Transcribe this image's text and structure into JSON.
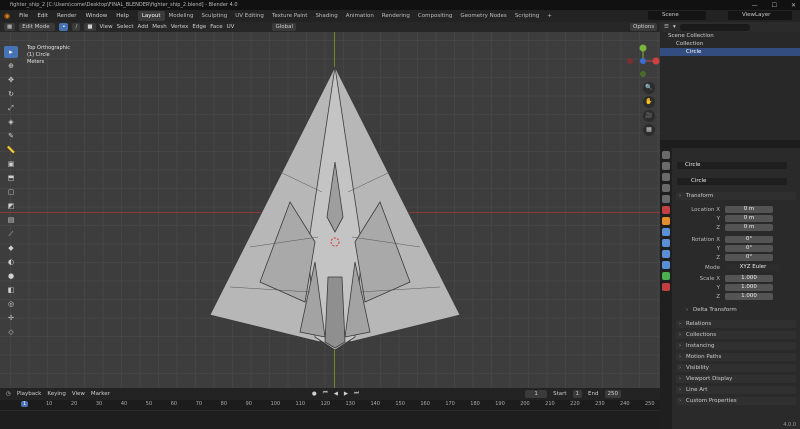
{
  "window": {
    "title": "fighter_ship_2 [C:\\Users\\come\\Desktop\\FINAL_BLENDER\\fighter_ship_2.blend] - Blender 4.0"
  },
  "menu": [
    "File",
    "Edit",
    "Render",
    "Window",
    "Help"
  ],
  "workspaces": [
    "Layout",
    "Modeling",
    "Sculpting",
    "UV Editing",
    "Texture Paint",
    "Shading",
    "Animation",
    "Rendering",
    "Compositing",
    "Geometry Nodes",
    "Scripting"
  ],
  "scene": "Scene",
  "view_layer": "ViewLayer",
  "header": {
    "mode": "Edit Mode",
    "view": "View",
    "select": "Select",
    "add": "Add",
    "mesh": "Mesh",
    "vertex": "Vertex",
    "edge": "Edge",
    "face": "Face",
    "uv": "UV",
    "transform_orientation": "Global",
    "options": "Options"
  },
  "viewport": {
    "line1": "Top Orthographic",
    "line2": "(1) Circle",
    "line3": "Meters"
  },
  "timeline": {
    "playback": "Playback",
    "keying": "Keying",
    "view": "View",
    "marker": "Marker",
    "current_frame": "1",
    "start_label": "Start",
    "start": "1",
    "end_label": "End",
    "end": "250",
    "ticks": [
      "1",
      "10",
      "20",
      "30",
      "40",
      "50",
      "60",
      "70",
      "80",
      "90",
      "100",
      "110",
      "120",
      "130",
      "140",
      "150",
      "160",
      "170",
      "180",
      "190",
      "200",
      "210",
      "220",
      "230",
      "240",
      "250"
    ]
  },
  "outliner": {
    "scene_collection": "Scene Collection",
    "collection": "Collection",
    "object": "Circle"
  },
  "properties": {
    "object_name": "Circle",
    "data_name": "Circle",
    "transform": "Transform",
    "location_x_label": "Location X",
    "y_label": "Y",
    "z_label": "Z",
    "loc_x": "0 m",
    "loc_y": "0 m",
    "loc_z": "0 m",
    "rotation_x_label": "Rotation X",
    "rot_x": "0°",
    "rot_y": "0°",
    "rot_z": "0°",
    "mode_label": "Mode",
    "mode": "XYZ Euler",
    "scale_x_label": "Scale X",
    "scale_x": "1.000",
    "scale_y": "1.000",
    "scale_z": "1.000",
    "delta": "Delta Transform",
    "panels": [
      "Relations",
      "Collections",
      "Instancing",
      "Motion Paths",
      "Visibility",
      "Viewport Display",
      "Line Art",
      "Custom Properties"
    ]
  },
  "version": "4.0.0",
  "colors": {
    "accent": "#4772b3",
    "x_axis": "#8a3a3a",
    "y_axis": "#6b8a2e"
  }
}
